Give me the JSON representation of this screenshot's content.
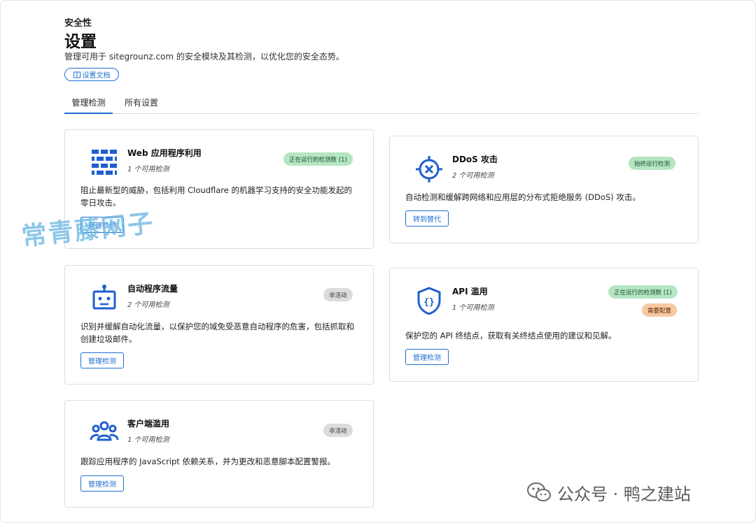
{
  "header": {
    "eyebrow": "安全性",
    "title": "设置",
    "subtitle": "管理可用于 sitegrounz.com 的安全模块及其检测，以优化您的安全态势。",
    "docs_label": "设置文档"
  },
  "tabs": [
    {
      "label": "管理检测",
      "active": true
    },
    {
      "label": "所有设置",
      "active": false
    }
  ],
  "cards": {
    "waf": {
      "icon": "brick-wall-icon",
      "name": "Web 应用程序利用",
      "count": "1 个可用检测",
      "badge": "正在运行的检测数 (1)",
      "desc_line1": "阻止最新型的威胁，包括利用 Cloudflare 的机器学习支持的安全功能发起的",
      "desc_line2": "零日攻击。",
      "button": "管理检测"
    },
    "ddos": {
      "icon": "crosshair-x-icon",
      "name": "DDoS 攻击",
      "count": "2 个可用检测",
      "badge": "始终运行检测",
      "desc_line1": "自动检测和缓解跨网络和应用层的分布式拒绝服务 (DDoS) 攻击。",
      "button": "转到替代"
    },
    "bot": {
      "icon": "robot-icon",
      "name": "自动程序流量",
      "count": "2 个可用检测",
      "badge": "非活动",
      "desc_line1": "识别并缓解自动化流量，以保护您的域免受恶意自动程序的危害，包括抓取和",
      "desc_line2": "创建垃圾邮件。",
      "button": "管理检测"
    },
    "api": {
      "icon": "shield-braces-icon",
      "name": "API 滥用",
      "count": "1 个可用检测",
      "badge": "正在运行的检测数 (1)",
      "badge2": "需要配置",
      "desc_line1": "保护您的 API 终结点，获取有关终结点使用的建议和见解。",
      "button": "管理检测"
    },
    "client": {
      "icon": "users-group-icon",
      "name": "客户端滥用",
      "count": "1 个可用检测",
      "badge": "非活动",
      "desc_line1": "跟踪应用程序的 JavaScript 依赖关系，并为更改和恶意脚本配置警报。",
      "button": "管理检测"
    }
  },
  "colors": {
    "accent": "#1f6fd1",
    "badge_green": "#b5e6c3",
    "badge_gray": "#dcdcdc",
    "badge_orange": "#f7c9a3"
  },
  "overlay": {
    "watermark": "常青藤网子",
    "footer": "公众号 · 鸭之建站"
  }
}
